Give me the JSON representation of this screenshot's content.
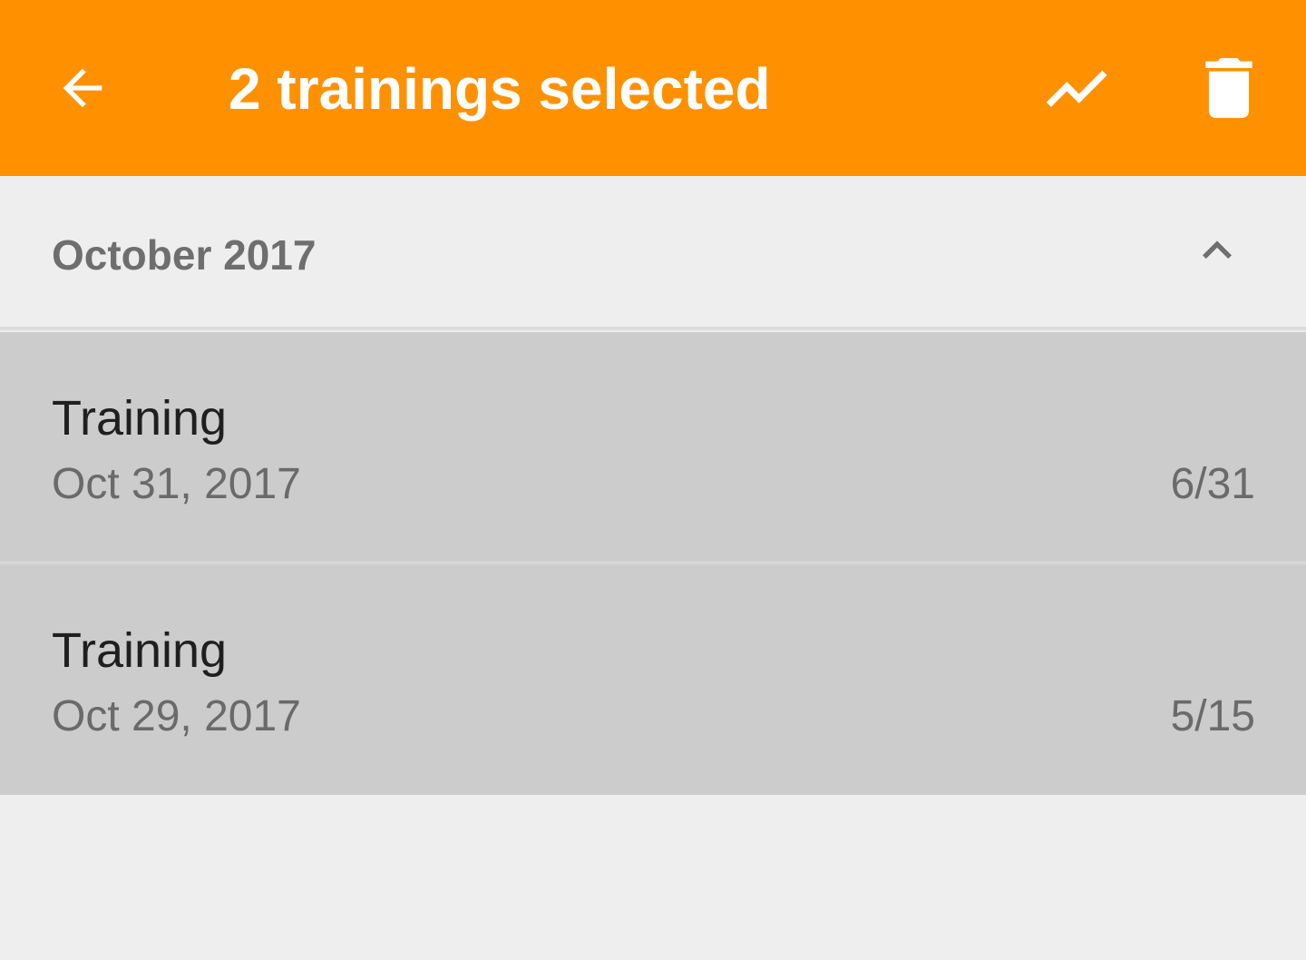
{
  "colors": {
    "appbar": "#ff9100",
    "selected_row": "#cccccc",
    "background": "#eeeeee"
  },
  "appbar": {
    "title": "2 trainings selected",
    "back_icon": "arrow-back-icon",
    "chart_icon": "trending-up-icon",
    "delete_icon": "delete-icon"
  },
  "section": {
    "title": "October 2017",
    "toggle_icon": "chevron-up-icon"
  },
  "trainings": [
    {
      "title": "Training",
      "date": "Oct 31, 2017",
      "score": "6/31",
      "selected": true
    },
    {
      "title": "Training",
      "date": "Oct 29, 2017",
      "score": "5/15",
      "selected": true
    }
  ]
}
